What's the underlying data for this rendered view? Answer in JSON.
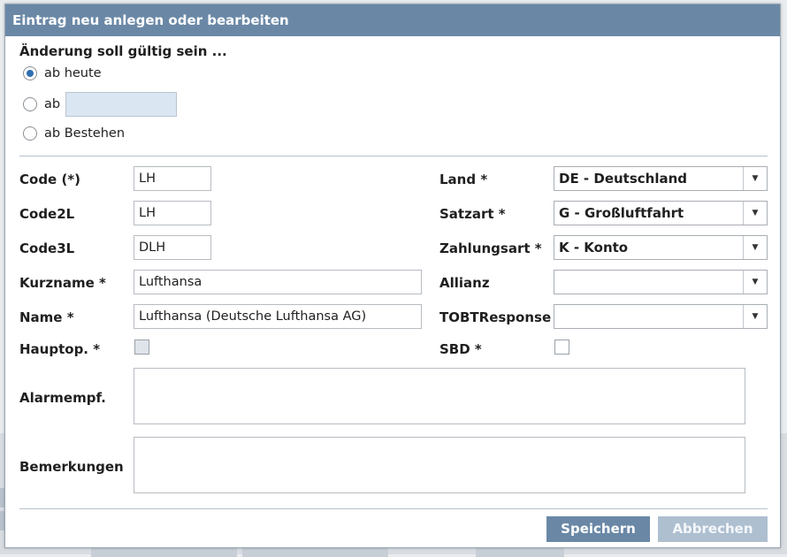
{
  "dialog": {
    "title": "Eintrag neu anlegen oder bearbeiten",
    "validity": {
      "heading": "Änderung soll gültig sein ...",
      "options": [
        {
          "label": "ab heute",
          "checked": true
        },
        {
          "label": "ab",
          "checked": false,
          "date_value": ""
        },
        {
          "label": "ab Bestehen",
          "checked": false
        }
      ]
    },
    "left_fields": {
      "code": {
        "label": "Code (*)",
        "value": "LH"
      },
      "code2l": {
        "label": "Code2L",
        "value": "LH"
      },
      "code3l": {
        "label": "Code3L",
        "value": "DLH"
      },
      "kurzname": {
        "label": "Kurzname *",
        "value": "Lufthansa"
      },
      "name": {
        "label": "Name *",
        "value": "Lufthansa (Deutsche Lufthansa AG)"
      },
      "hauptop": {
        "label": "Hauptop. *",
        "checked": false
      }
    },
    "right_fields": {
      "land": {
        "label": "Land *",
        "value": "DE - Deutschland"
      },
      "satzart": {
        "label": "Satzart *",
        "value": "G - Großluftfahrt"
      },
      "zahlungsart": {
        "label": "Zahlungsart *",
        "value": "K - Konto"
      },
      "allianz": {
        "label": "Allianz",
        "value": ""
      },
      "tobtresponse": {
        "label": "TOBTResponse",
        "value": ""
      },
      "sbd": {
        "label": "SBD *",
        "checked": false
      }
    },
    "alarmempf": {
      "label": "Alarmempf.",
      "value": ""
    },
    "bemerkungen": {
      "label": "Bemerkungen",
      "value": ""
    },
    "buttons": {
      "save": "Speichern",
      "cancel": "Abbrechen"
    },
    "colors": {
      "titlebar": "#6a88a6",
      "save": "#6a88a6",
      "cancel_disabled": "#aebfd0"
    },
    "icons": {
      "dropdown": "chevron-down-icon"
    }
  }
}
